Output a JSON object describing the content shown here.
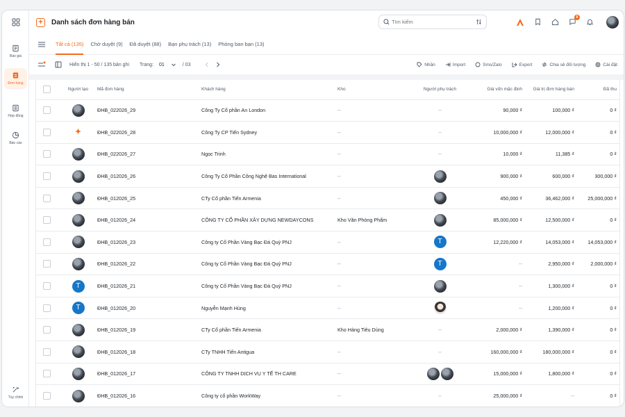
{
  "sidebar": {
    "items": [
      {
        "label": "Báo giá",
        "icon": "quote-icon"
      },
      {
        "label": "Đơn hàng",
        "icon": "order-icon",
        "active": true
      },
      {
        "label": "Hợp đồng",
        "icon": "contract-icon"
      },
      {
        "label": "Báo cáo",
        "icon": "report-icon"
      }
    ],
    "bottom": {
      "label": "Tùy chỉnh",
      "icon": "customize-icon"
    }
  },
  "header": {
    "title": "Danh sách đơn hàng bán",
    "search_placeholder": "Tìm kiếm",
    "notification_count": "8"
  },
  "tabs": [
    {
      "label": "Tất cả (135)",
      "active": true
    },
    {
      "label": "Chờ duyệt (9)"
    },
    {
      "label": "Đã duyệt (88)"
    },
    {
      "label": "Bạn phụ trách (13)"
    },
    {
      "label": "Phòng ban bạn (13)"
    }
  ],
  "toolbar": {
    "showing": "Hiển thị 1 - 50 / 135 bản ghi",
    "page_label": "Trang:",
    "page_current": "01",
    "page_total": "/ 03",
    "actions": [
      "Nhãn",
      "Import",
      "Sms/Zalo",
      "Export",
      "Chia sẻ đối tượng",
      "Cài đặt"
    ]
  },
  "table": {
    "columns": [
      "Người tạo",
      "Mã đơn hàng",
      "Khách hàng",
      "Kho",
      "Người phụ trách",
      "Giá vốn mặc định",
      "Giá trị đơn hàng bán",
      "Đã thu"
    ],
    "rows": [
      {
        "creator": "photo",
        "code": "ĐHB_022026_29",
        "customer": "Công Ty Cổ phần An London",
        "warehouse": "--",
        "assignee": "--",
        "cost": "90,000 ₫",
        "value": "100,000 ₫",
        "paid": "0 ₫"
      },
      {
        "creator": "logo",
        "code": "ĐHB_022026_28",
        "customer": "Công Ty CP Tiến Sydney",
        "warehouse": "--",
        "assignee": "--",
        "cost": "10,000,000 ₫",
        "value": "12,000,000 ₫",
        "paid": "0 ₫"
      },
      {
        "creator": "photo",
        "code": "ĐHB_022026_27",
        "customer": "Ngọc Trinh",
        "warehouse": "--",
        "assignee": "--",
        "cost": "10,000 ₫",
        "value": "11,385 ₫",
        "paid": "0 ₫"
      },
      {
        "creator": "photo",
        "code": "ĐHB_012026_26",
        "customer": "Công Ty Cổ Phần Công Nghệ Bas International",
        "warehouse": "--",
        "assignee": "photo",
        "cost": "900,000 ₫",
        "value": "600,000 ₫",
        "paid": "300,000 ₫"
      },
      {
        "creator": "photo",
        "code": "ĐHB_012026_25",
        "customer": "CTy Cổ phần Tiến Armenia",
        "warehouse": "--",
        "assignee": "photo",
        "cost": "450,000 ₫",
        "value": "36,462,000 ₫",
        "paid": "25,000,000 ₫"
      },
      {
        "creator": "photo",
        "code": "ĐHB_012026_24",
        "customer": "CÔNG TY CỔ PHẦN XÂY DỰNG NEWDAYCONS",
        "warehouse": "Kho Văn Phòng Phẩm",
        "assignee": "photo",
        "cost": "85,000,000 ₫",
        "value": "12,500,000 ₫",
        "paid": "0 ₫"
      },
      {
        "creator": "photo",
        "code": "ĐHB_012026_23",
        "customer": "Công ty Cổ Phần Vàng Bạc Đá Quý PNJ",
        "warehouse": "--",
        "assignee": "T",
        "cost": "12,220,000 ₫",
        "value": "14,053,000 ₫",
        "paid": "14,053,000 ₫"
      },
      {
        "creator": "photo",
        "code": "ĐHB_012026_22",
        "customer": "Công ty Cổ Phần Vàng Bạc Đá Quý PNJ",
        "warehouse": "--",
        "assignee": "T",
        "cost": "--",
        "value": "2,950,000 ₫",
        "paid": "2,000,000 ₫"
      },
      {
        "creator": "T",
        "code": "ĐHB_012026_21",
        "customer": "Công ty Cổ Phần Vàng Bạc Đá Quý PNJ",
        "warehouse": "--",
        "assignee": "photo",
        "cost": "--",
        "value": "1,300,000 ₫",
        "paid": "0 ₫"
      },
      {
        "creator": "T",
        "code": "ĐHB_012026_20",
        "customer": "Nguyễn Mạnh Hùng",
        "warehouse": "--",
        "assignee": "face",
        "cost": "--",
        "value": "1,200,000 ₫",
        "paid": "0 ₫"
      },
      {
        "creator": "photo",
        "code": "ĐHB_012026_19",
        "customer": "CTy Cổ phần Tiến Armenia",
        "warehouse": "Kho Hàng Tiêu Dùng",
        "assignee": "--",
        "cost": "2,000,000 ₫",
        "value": "1,390,000 ₫",
        "paid": "0 ₫"
      },
      {
        "creator": "photo",
        "code": "ĐHB_012026_18",
        "customer": "CTy TNHH Tiến Antigua",
        "warehouse": "--",
        "assignee": "--",
        "cost": "160,000,000 ₫",
        "value": "180,000,000 ₫",
        "paid": "0 ₫"
      },
      {
        "creator": "photo",
        "code": "ĐHB_012026_17",
        "customer": "CÔNG TY TNHH DỊCH VỤ Y TẾ TH CARE",
        "warehouse": "--",
        "assignee": "photo2",
        "cost": "15,000,000 ₫",
        "value": "1,800,000 ₫",
        "paid": "0 ₫"
      },
      {
        "creator": "photo",
        "code": "ĐHB_012026_16",
        "customer": "Công ty cổ phần WorkWay",
        "warehouse": "--",
        "assignee": "--",
        "cost": "25,000,000 ₫",
        "value": "--",
        "paid": "0 ₫"
      }
    ]
  },
  "colors": {
    "accent": "#f26b1d",
    "avatar_blue": "#1677c8"
  }
}
